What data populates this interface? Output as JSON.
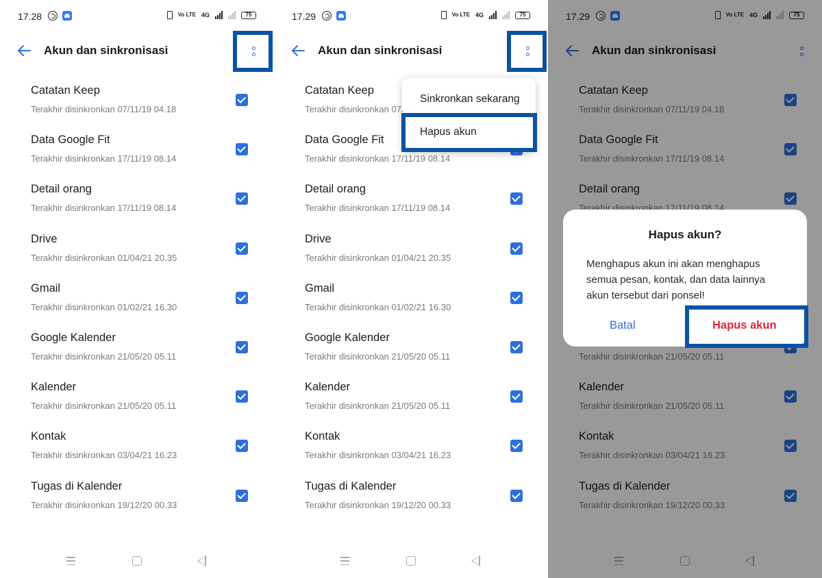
{
  "colors": {
    "accent": "#2f6fdc",
    "highlight": "#0b52a3",
    "danger": "#e0263f",
    "overlay": "rgba(0,0,0,0.40)"
  },
  "app": {
    "title": "Akun dan sinkronisasi"
  },
  "statusbar": {
    "time_1": "17.28",
    "time_2": "17.29",
    "time_3": "17.29",
    "volte": "Vo LTE",
    "network": "4G",
    "battery": "75"
  },
  "items": [
    {
      "name": "Catatan Keep",
      "sub": "Terakhir disinkronkan 07/11/19 04.18",
      "checked": true
    },
    {
      "name": "Data Google Fit",
      "sub": "Terakhir disinkronkan 17/11/19 08.14",
      "checked": true
    },
    {
      "name": "Detail orang",
      "sub": "Terakhir disinkronkan 17/11/19 08.14",
      "checked": true
    },
    {
      "name": "Drive",
      "sub": "Terakhir disinkronkan 01/04/21 20.35",
      "checked": true
    },
    {
      "name": "Gmail",
      "sub": "Terakhir disinkronkan 01/02/21 16.30",
      "checked": true
    },
    {
      "name": "Google Kalender",
      "sub": "Terakhir disinkronkan 21/05/20 05.11",
      "checked": true
    },
    {
      "name": "Kalender",
      "sub": "Terakhir disinkronkan 21/05/20 05.11",
      "checked": true
    },
    {
      "name": "Kontak",
      "sub": "Terakhir disinkronkan 03/04/21 16.23",
      "checked": true
    },
    {
      "name": "Tugas di Kalender",
      "sub": "Terakhir disinkronkan 19/12/20 00.33",
      "checked": true
    }
  ],
  "menu": {
    "sync_now": "Sinkronkan sekarang",
    "remove_account": "Hapus akun"
  },
  "dialog": {
    "title": "Hapus akun?",
    "message": "Menghapus akun ini akan menghapus semua pesan, kontak, dan data lainnya akun tersebut dari ponsel!",
    "cancel": "Batal",
    "confirm": "Hapus akun"
  }
}
